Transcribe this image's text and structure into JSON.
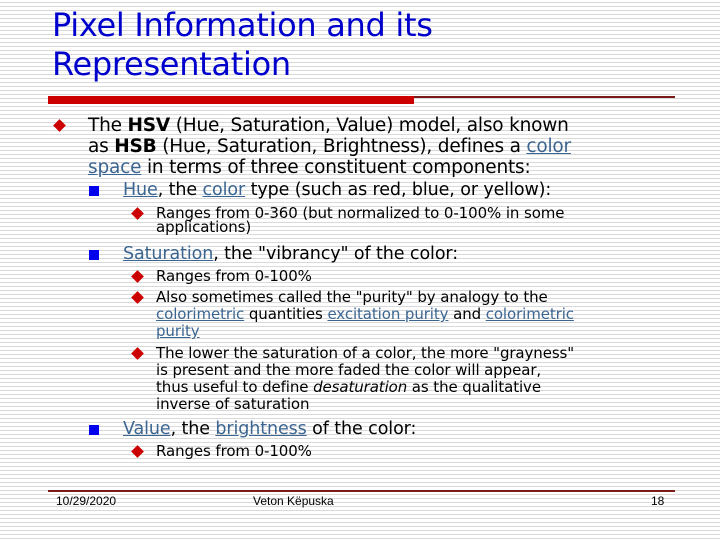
{
  "slide": {
    "title_line1": "Pixel Information and its",
    "title_line2": "Representation",
    "colors": {
      "title": "#0000cc",
      "accent_bar": "#cc0000",
      "rule": "#7a1a1a",
      "link": "#3b6591",
      "level1_bullet": "#cc0000",
      "level2_bullet": "#0000ee",
      "level3_bullet": "#cc0000"
    },
    "main_bullet": {
      "icon": "red-diamond-bullet",
      "parts": {
        "p1": "The ",
        "b1": "HSV",
        "p2": " (Hue, Saturation, Value) model, also known",
        "p3": "as ",
        "b2": "HSB",
        "p4": " (Hue, Saturation, Brightness), defines a ",
        "link1": "color",
        "link2": "space",
        "p5": " in terms of three constituent components:"
      }
    },
    "hue": {
      "icon": "blue-square-bullet",
      "link_hue": "Hue",
      "t1": ", the ",
      "link_color": "color",
      "t2": " type (such as red, blue, or yellow):",
      "sub": [
        {
          "line1": "Ranges from 0-360 (but normalized to 0-100% in some",
          "line2": "applications)"
        }
      ]
    },
    "saturation": {
      "icon": "blue-square-bullet",
      "link_saturation": "Saturation",
      "t1": ", the \"vibrancy\" of the color:",
      "sub1": "Ranges from 0-100%",
      "sub2": {
        "line1": "Also sometimes called the \"purity\" by analogy to the",
        "link_colorimetric1": "colorimetric",
        "t_quantities": " quantities ",
        "link_excitation": "excitation purity",
        "t_and": " and ",
        "link_colorimetric2": "colorimetric",
        "link_purity": "purity"
      },
      "sub3": {
        "line1": "The lower the saturation of a color, the more \"grayness\"",
        "line2": "is present and the more faded the color will appear,",
        "line3a": "thus useful to define ",
        "line3i": "desaturation",
        "line3b": " as the qualitative",
        "line4": "inverse of saturation"
      }
    },
    "value": {
      "icon": "blue-square-bullet",
      "link_value": "Value",
      "t1": ", the ",
      "link_brightness": "brightness",
      "t2": " of the color:",
      "sub1": "Ranges from 0-100%"
    },
    "footer": {
      "date": "10/29/2020",
      "author": "Veton Këpuska",
      "page": "18"
    }
  }
}
